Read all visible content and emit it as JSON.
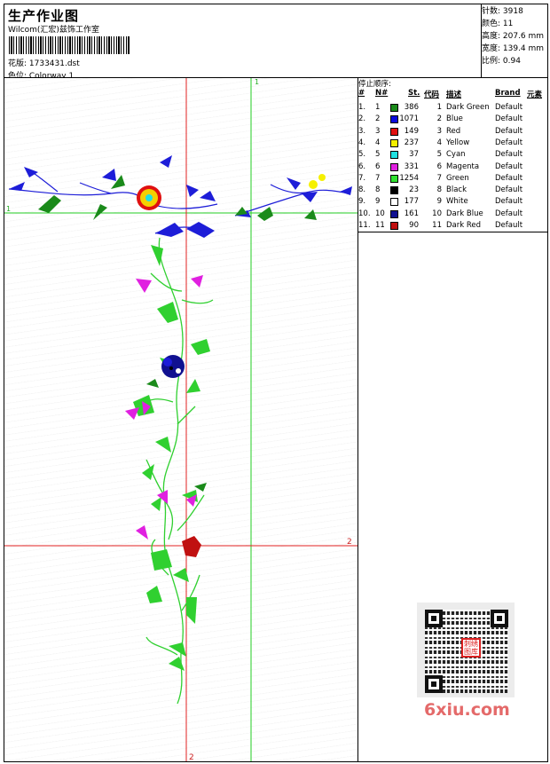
{
  "header": {
    "title": "生产作业图",
    "subtitle": "Wilcom(汇宏)兹饰工作室",
    "design_label": "花版: 1733431.dst",
    "colorway_label": "色位: Colorway 1"
  },
  "stats": {
    "stitches": "针数: 3918",
    "colors": "颜色: 11",
    "height": "高度: 207.6 mm",
    "width": "宽度: 139.4 mm",
    "scale": "比例: 0.94"
  },
  "table": {
    "title": "停止顺序:",
    "headers": [
      "#",
      "N#",
      "St.",
      "代码",
      "描述",
      "Brand",
      "元素"
    ],
    "rows": [
      {
        "num": "1.",
        "n": "1",
        "color": "#1a8a1a",
        "st": "386",
        "code": "1",
        "desc": "Dark Green",
        "brand": "Default"
      },
      {
        "num": "2.",
        "n": "2",
        "color": "#0a0adc",
        "st": "1071",
        "code": "2",
        "desc": "Blue",
        "brand": "Default"
      },
      {
        "num": "3.",
        "n": "3",
        "color": "#e01010",
        "st": "149",
        "code": "3",
        "desc": "Red",
        "brand": "Default"
      },
      {
        "num": "4.",
        "n": "4",
        "color": "#f5f000",
        "st": "237",
        "code": "4",
        "desc": "Yellow",
        "brand": "Default"
      },
      {
        "num": "5.",
        "n": "5",
        "color": "#20e0e0",
        "st": "37",
        "code": "5",
        "desc": "Cyan",
        "brand": "Default"
      },
      {
        "num": "6.",
        "n": "6",
        "color": "#e020e0",
        "st": "331",
        "code": "6",
        "desc": "Magenta",
        "brand": "Default"
      },
      {
        "num": "7.",
        "n": "7",
        "color": "#30e030",
        "st": "1254",
        "code": "7",
        "desc": "Green",
        "brand": "Default"
      },
      {
        "num": "8.",
        "n": "8",
        "color": "#000000",
        "st": "23",
        "code": "8",
        "desc": "Black",
        "brand": "Default"
      },
      {
        "num": "9.",
        "n": "9",
        "color": "#ffffff",
        "st": "177",
        "code": "9",
        "desc": "White",
        "brand": "Default"
      },
      {
        "num": "10.",
        "n": "10",
        "color": "#101090",
        "st": "161",
        "code": "10",
        "desc": "Dark Blue",
        "brand": "Default"
      },
      {
        "num": "11.",
        "n": "11",
        "color": "#c01010",
        "st": "90",
        "code": "11",
        "desc": "Dark Red",
        "brand": "Default"
      }
    ]
  },
  "guides": {
    "h1": "1",
    "v1": "1",
    "h2": "2",
    "v2": "2"
  },
  "qr_seal_text": "刺绣图库",
  "watermark": "6xiu.com"
}
